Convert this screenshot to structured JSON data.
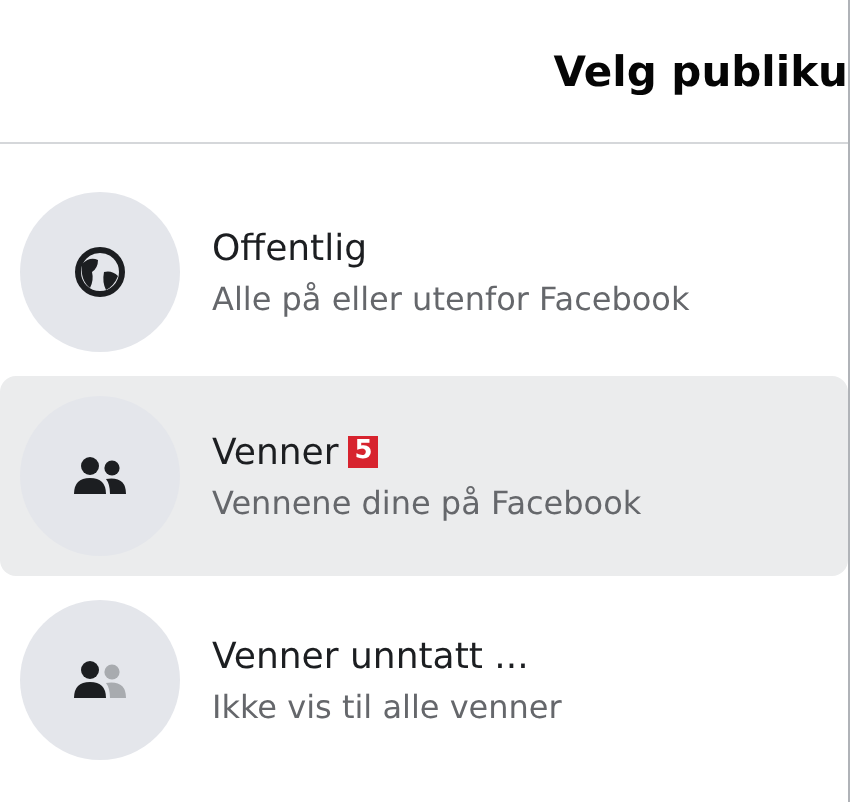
{
  "header": {
    "title": "Velg publiku"
  },
  "options": [
    {
      "kind": "globe",
      "label": "Offentlig",
      "description": "Alle på eller utenfor Facebook",
      "selected": false
    },
    {
      "kind": "friends",
      "label": "Venner",
      "badge": "5",
      "description": "Vennene dine på Facebook",
      "selected": true
    },
    {
      "kind": "friends-except",
      "label": "Venner unntatt ...",
      "description": "Ikke vis til alle venner",
      "selected": false
    }
  ]
}
